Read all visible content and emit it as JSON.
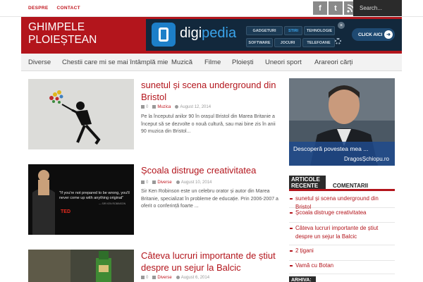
{
  "topbar": {
    "links": [
      "DESPRE",
      "CONTACT"
    ],
    "social": [
      {
        "icon": "facebook-icon",
        "glyph": "f"
      },
      {
        "icon": "twitter-icon",
        "glyph": "t"
      },
      {
        "icon": "rss-icon",
        "glyph": "r"
      }
    ],
    "search_placeholder": "Search..."
  },
  "header": {
    "title_line1": "GHIMPELE",
    "title_line2": "PLOIEȘTEAN",
    "brand_color": "#b3151c"
  },
  "banner": {
    "brand_a": "digi",
    "brand_b": "pedia",
    "tags": [
      "GADGETURI",
      "STIRI",
      "TEHNOLOGIE",
      "SOFTWARE",
      "JOCURI",
      "TELEFOANE"
    ],
    "cta": "CLICK AICI"
  },
  "nav": {
    "items": [
      "Diverse",
      "Chestii care mi se mai întâmplă mie",
      "Muzică",
      "Filme",
      "Ploiești",
      "Uneori sport",
      "Arareori cărți"
    ]
  },
  "posts": [
    {
      "title": "sunetul și scena underground din Bristol",
      "comments": "0",
      "category": "Muzica",
      "date": "August 12, 2014",
      "excerpt": "Pe la începutul anilor 90 în orașul Bristol din Marea Britanie a început să se dezvolte o nouă cultură, sau mai bine zis în anii 90 muzica din Bristol..."
    },
    {
      "title": "Școala distruge creativitatea",
      "comments": "0",
      "category": "Diverse",
      "date": "August 10, 2014",
      "excerpt": "Sir Ken Robinson este un celebru orator și autor din Marea Britanie, specializat în probleme de educație. Prin 2006-2007 a oferit o conferință foarte ...",
      "quote": "\"If you're not prepared to be wrong, you'll never come up with anything original\"",
      "quote_author": "— SIR KEN ROBINSON",
      "badge": "TED"
    },
    {
      "title": "Câteva lucruri importante de știut despre un sejur la Balcic",
      "comments": "0",
      "category": "Diverse",
      "date": "August 6, 2014"
    }
  ],
  "sidebar": {
    "ad_line1": "Descoperă povestea mea ...",
    "ad_line2": "DragosȘchiopu.ro",
    "tab_active": "ARTICOLE RECENTE",
    "tab_inactive": "COMENTARII",
    "recent": [
      "sunetul și scena underground din Bristol",
      "Școala distruge creativitatea",
      "Câteva lucruri importante de știut despre un sejur la Balcic",
      "2 țigani",
      "Vamă cu Botan"
    ],
    "archive": "ARHIVA:"
  }
}
